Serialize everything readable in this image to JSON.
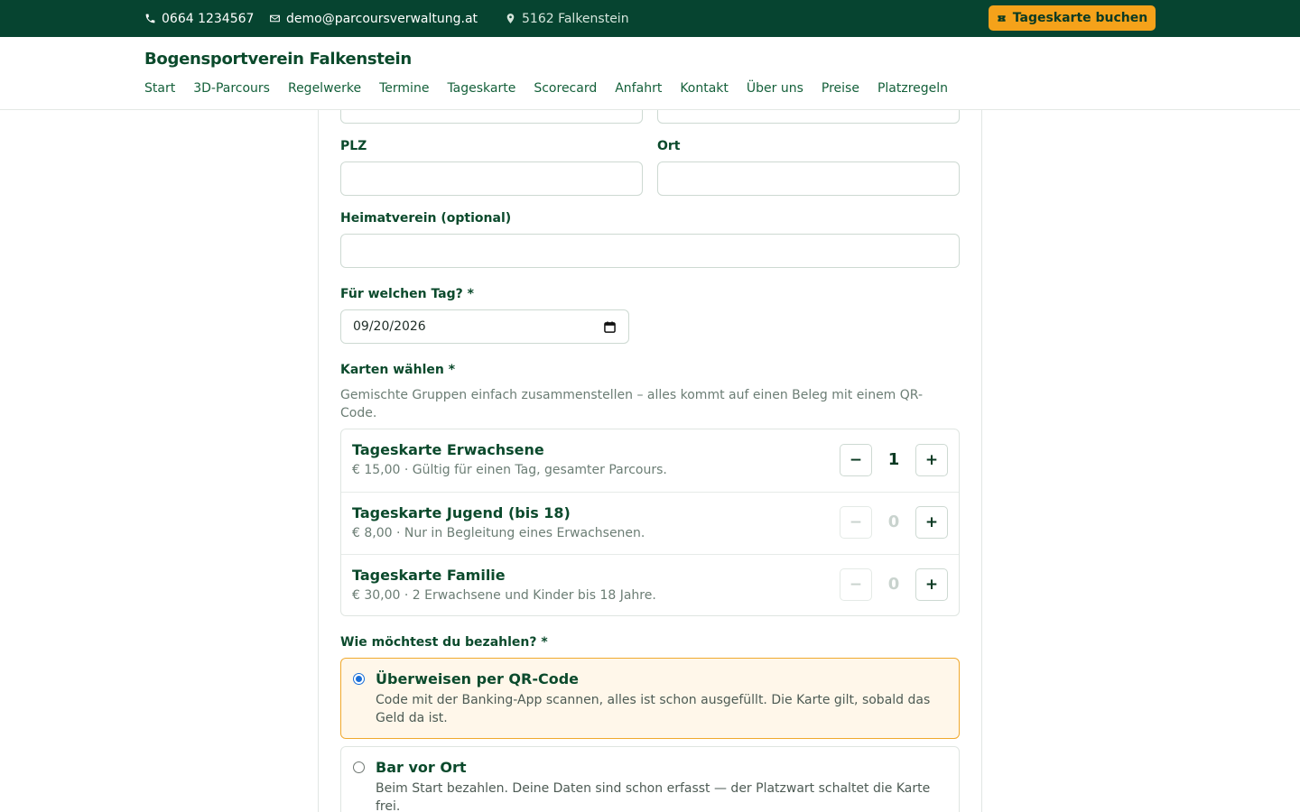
{
  "topbar": {
    "phone": "0664 1234567",
    "email": "demo@parcoursverwaltung.at",
    "location": "5162 Falkenstein",
    "cta_label": "Tageskarte buchen"
  },
  "header": {
    "brand": "Bogensportverein Falkenstein",
    "nav": [
      "Start",
      "3D-Parcours",
      "Regelwerke",
      "Termine",
      "Tageskarte",
      "Scorecard",
      "Anfahrt",
      "Kontakt",
      "Über uns",
      "Preise",
      "Platzregeln"
    ]
  },
  "form": {
    "plz_label": "PLZ",
    "ort_label": "Ort",
    "plz_value": "",
    "ort_value": "",
    "club_label": "Heimatverein (optional)",
    "club_value": "",
    "day_label": "Für welchen Tag? *",
    "day_value": "09/20/2026",
    "cards_label": "Karten wählen *",
    "cards_hint": "Gemischte Gruppen einfach zusammenstellen – alles kommt auf einen Beleg mit einem QR-Code.",
    "tickets": [
      {
        "name": "Tageskarte Erwachsene",
        "desc": "€ 15,00 · Gültig für einen Tag, gesamter Parcours.",
        "qty": "1",
        "minus": "−",
        "plus": "+"
      },
      {
        "name": "Tageskarte Jugend (bis 18)",
        "desc": "€ 8,00 · Nur in Begleitung eines Erwachsenen.",
        "qty": "0",
        "minus": "−",
        "plus": "+"
      },
      {
        "name": "Tageskarte Familie",
        "desc": "€ 30,00 · 2 Erwachsene und Kinder bis 18 Jahre.",
        "qty": "0",
        "minus": "−",
        "plus": "+"
      }
    ],
    "pay_label": "Wie möchtest du bezahlen? *",
    "payment": [
      {
        "title": "Überweisen per QR-Code",
        "desc": "Code mit der Banking-App scannen, alles ist schon ausgefüllt. Die Karte gilt, sobald das Geld da ist.",
        "selected": true
      },
      {
        "title": "Bar vor Ort",
        "desc": "Beim Start bezahlen. Deine Daten sind schon erfasst — der Platzwart schaltet die Karte frei.",
        "selected": false
      }
    ]
  },
  "colors": {
    "topbar_bg": "#064430",
    "accent": "#f5a21a",
    "brand_text": "#0b4a2c",
    "radio_selected": "#1a6fd8"
  },
  "icons": {
    "phone": "phone-icon",
    "email": "mail-icon",
    "location": "map-pin-icon",
    "cta": "ticket-icon",
    "date": "calendar-icon"
  }
}
